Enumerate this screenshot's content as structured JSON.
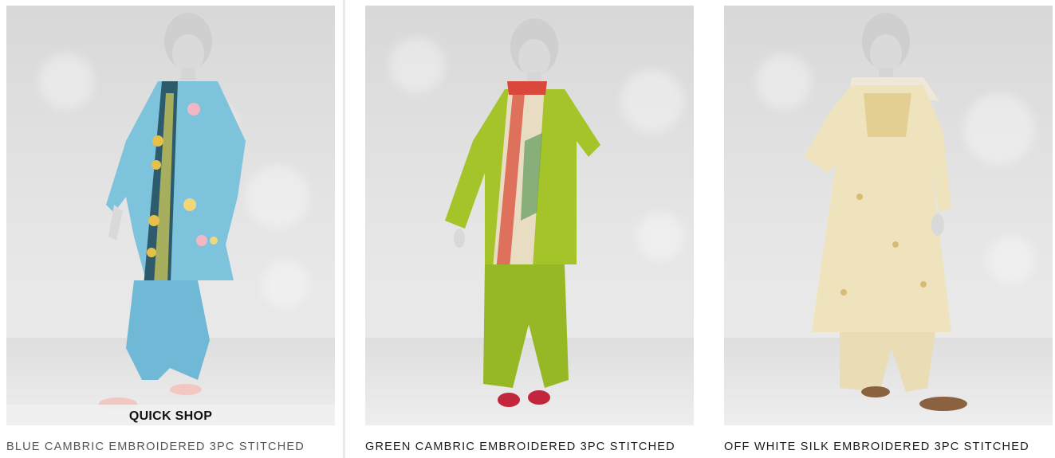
{
  "products": [
    {
      "title": "BLUE CAMBRIC EMBROIDERED 3PC STITCHED",
      "quick_shop": "QUICK SHOP",
      "colors": {
        "dress": "#7ec3dc",
        "dupatta": "#2e5b6b",
        "shoes": "#f2c7c2"
      }
    },
    {
      "title": "GREEN CAMBRIC EMBROIDERED 3PC STITCHED",
      "colors": {
        "dress": "#a4c42a",
        "dupatta": "#e8dcc3",
        "shoes": "#c2263d"
      }
    },
    {
      "title": "OFF WHITE SILK EMBROIDERED 3PC STITCHED",
      "colors": {
        "dress": "#efe3bd",
        "dupatta": "#f1e8d6",
        "shoes": "#8a6240"
      }
    }
  ]
}
